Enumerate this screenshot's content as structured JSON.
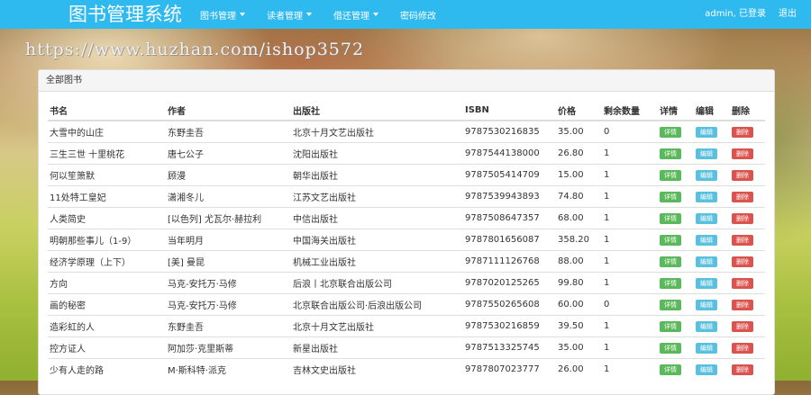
{
  "navbar": {
    "brand": "图书管理系统",
    "menu": [
      {
        "label": "图书管理"
      },
      {
        "label": "读者管理"
      },
      {
        "label": "借还管理"
      },
      {
        "label": "密码修改"
      }
    ],
    "user_status": "admin, 已登录",
    "logout": "退出"
  },
  "watermark": "https://www.huzhan.com/ishop3572",
  "panel": {
    "title": "全部图书",
    "columns": [
      "书名",
      "作者",
      "出版社",
      "ISBN",
      "价格",
      "剩余数量",
      "详情",
      "编辑",
      "删除"
    ],
    "actions": {
      "detail": "详情",
      "edit": "编辑",
      "delete": "删除"
    },
    "rows": [
      {
        "name": "大雪中的山庄",
        "author": "东野圭吾",
        "publisher": "北京十月文艺出版社",
        "isbn": "9787530216835",
        "price": "35.00",
        "qty": "0"
      },
      {
        "name": "三生三世 十里桃花",
        "author": "唐七公子",
        "publisher": "沈阳出版社",
        "isbn": "9787544138000",
        "price": "26.80",
        "qty": "1"
      },
      {
        "name": "何以笙箫默",
        "author": "顾漫",
        "publisher": "朝华出版社",
        "isbn": "9787505414709",
        "price": "15.00",
        "qty": "1"
      },
      {
        "name": "11处特工皇妃",
        "author": "潇湘冬儿",
        "publisher": "江苏文艺出版社",
        "isbn": "9787539943893",
        "price": "74.80",
        "qty": "1"
      },
      {
        "name": "人类简史",
        "author": "[以色列] 尤瓦尔·赫拉利",
        "publisher": "中信出版社",
        "isbn": "9787508647357",
        "price": "68.00",
        "qty": "1"
      },
      {
        "name": "明朝那些事儿（1-9）",
        "author": "当年明月",
        "publisher": "中国海关出版社",
        "isbn": "9787801656087",
        "price": "358.20",
        "qty": "1"
      },
      {
        "name": "经济学原理（上下）",
        "author": "[美] 曼昆",
        "publisher": "机械工业出版社",
        "isbn": "9787111126768",
        "price": "88.00",
        "qty": "1"
      },
      {
        "name": "方向",
        "author": "马克-安托万·马修",
        "publisher": "后浪丨北京联合出版公司",
        "isbn": "9787020125265",
        "price": "99.80",
        "qty": "1"
      },
      {
        "name": "画的秘密",
        "author": "马克-安托万·马修",
        "publisher": "北京联合出版公司·后浪出版公司",
        "isbn": "9787550265608",
        "price": "60.00",
        "qty": "0"
      },
      {
        "name": "造彩虹的人",
        "author": "东野圭吾",
        "publisher": "北京十月文艺出版社",
        "isbn": "9787530216859",
        "price": "39.50",
        "qty": "1"
      },
      {
        "name": "控方证人",
        "author": "阿加莎·克里斯蒂",
        "publisher": "新星出版社",
        "isbn": "9787513325745",
        "price": "35.00",
        "qty": "1"
      },
      {
        "name": "少有人走的路",
        "author": "M·斯科特·派克",
        "publisher": "吉林文史出版社",
        "isbn": "9787807023777",
        "price": "26.00",
        "qty": "1"
      }
    ]
  },
  "colors": {
    "navbar": "#2eb9ef",
    "detail": "#5cb85c",
    "edit": "#5bc0de",
    "delete": "#d9534f"
  }
}
